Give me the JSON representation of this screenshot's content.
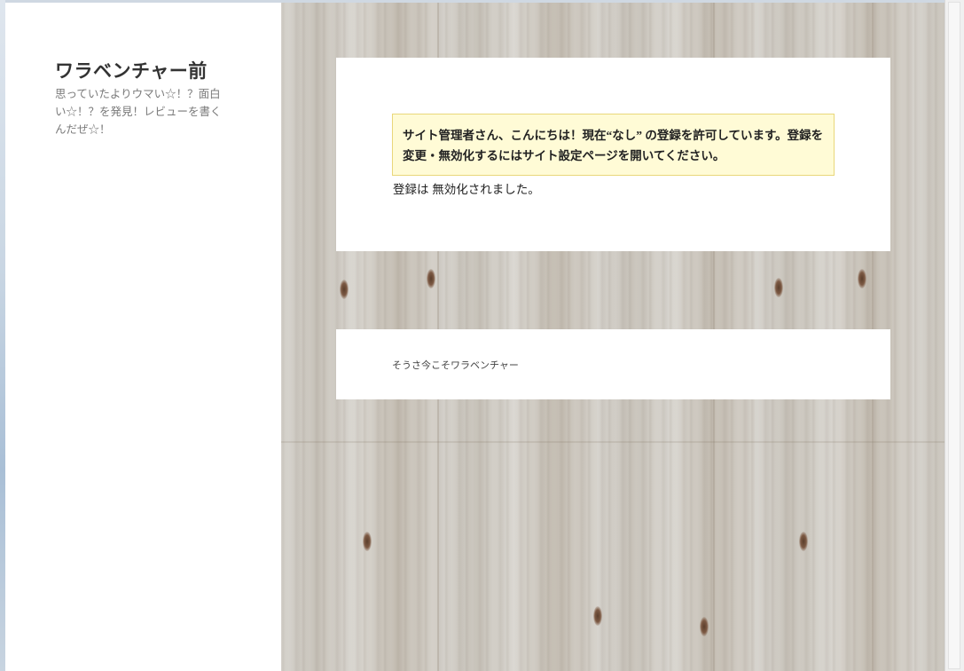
{
  "site": {
    "title": "ワラベンチャー前",
    "description": "思っていたよりウマい☆！？面白い☆！？を発見！レビューを書くんだぜ☆！"
  },
  "main": {
    "notice": "サイト管理者さん、こんにちは！現在“なし” の登録を許可しています。登録を変更・無効化するにはサイト設定ページを開いてください。",
    "status": "登録は 無効化されました。"
  },
  "footer": {
    "text": "そうさ今こそワラベンチャー"
  }
}
